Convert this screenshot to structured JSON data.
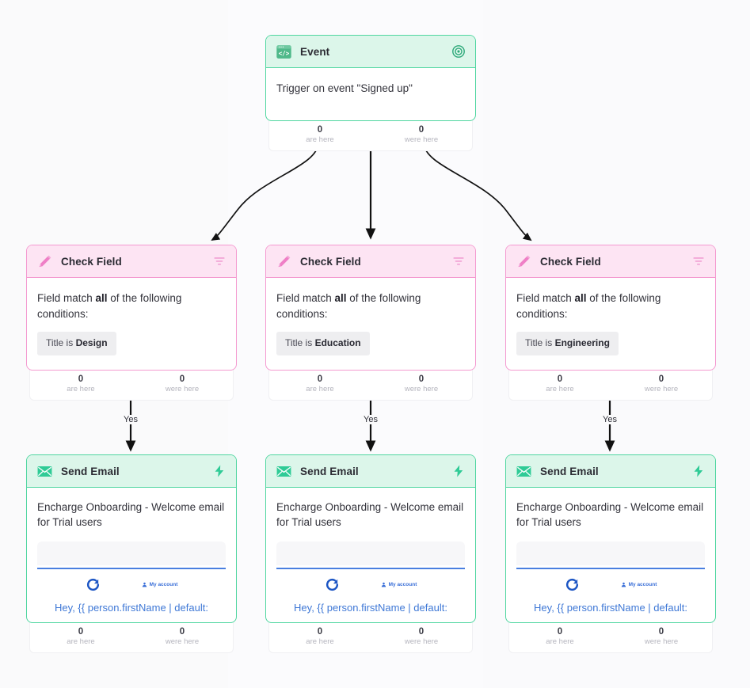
{
  "canvas": {
    "background": "#fafafb",
    "accent_green": "#4fd6a0",
    "accent_pink": "#f49ad0",
    "accent_blue": "#3f78d6"
  },
  "nodes": {
    "event": {
      "title": "Event",
      "icon": "code-window-icon",
      "action_icon": "target-icon",
      "body": "Trigger on event \"Signed up\"",
      "stats": {
        "are_num": "0",
        "are_label": "are here",
        "were_num": "0",
        "were_label": "were here"
      }
    },
    "check_fields": [
      {
        "title": "Check Field",
        "icon": "pencil-icon",
        "action_icon": "filter-icon",
        "prefix": "Field match ",
        "match": "all",
        "suffix": " of the following conditions:",
        "chip_prefix": "Title is ",
        "chip_value": "Design",
        "stats": {
          "are_num": "0",
          "are_label": "are here",
          "were_num": "0",
          "were_label": "were here"
        }
      },
      {
        "title": "Check Field",
        "icon": "pencil-icon",
        "action_icon": "filter-icon",
        "prefix": "Field match ",
        "match": "all",
        "suffix": " of the following conditions:",
        "chip_prefix": "Title is ",
        "chip_value": "Education",
        "stats": {
          "are_num": "0",
          "are_label": "are here",
          "were_num": "0",
          "were_label": "were here"
        }
      },
      {
        "title": "Check Field",
        "icon": "pencil-icon",
        "action_icon": "filter-icon",
        "prefix": "Field match ",
        "match": "all",
        "suffix": " of the following conditions:",
        "chip_prefix": "Title is ",
        "chip_value": "Engineering",
        "stats": {
          "are_num": "0",
          "are_label": "are here",
          "were_num": "0",
          "were_label": "were here"
        }
      }
    ],
    "send_emails": [
      {
        "title": "Send Email",
        "icon": "envelope-icon",
        "action_icon": "lightning-icon",
        "subject": "Encharge Onboarding - Welcome email for Trial users",
        "preview": {
          "logo_icon": "refresh-logo-icon",
          "account_icon": "user-icon",
          "account_label": "My account",
          "greeting": "Hey, {{ person.firstName | default:"
        },
        "stats": {
          "are_num": "0",
          "are_label": "are here",
          "were_num": "0",
          "were_label": "were here"
        }
      },
      {
        "title": "Send Email",
        "icon": "envelope-icon",
        "action_icon": "lightning-icon",
        "subject": "Encharge Onboarding - Welcome email for Trial users",
        "preview": {
          "logo_icon": "refresh-logo-icon",
          "account_icon": "user-icon",
          "account_label": "My account",
          "greeting": "Hey, {{ person.firstName | default:"
        },
        "stats": {
          "are_num": "0",
          "are_label": "are here",
          "were_num": "0",
          "were_label": "were here"
        }
      },
      {
        "title": "Send Email",
        "icon": "envelope-icon",
        "action_icon": "lightning-icon",
        "subject": "Encharge Onboarding - Welcome email for Trial users",
        "preview": {
          "logo_icon": "refresh-logo-icon",
          "account_icon": "user-icon",
          "account_label": "My account",
          "greeting": "Hey, {{ person.firstName | default:"
        },
        "stats": {
          "are_num": "0",
          "are_label": "are here",
          "were_num": "0",
          "were_label": "were here"
        }
      }
    ]
  },
  "edges": {
    "yes_labels": [
      "Yes",
      "Yes",
      "Yes"
    ]
  }
}
